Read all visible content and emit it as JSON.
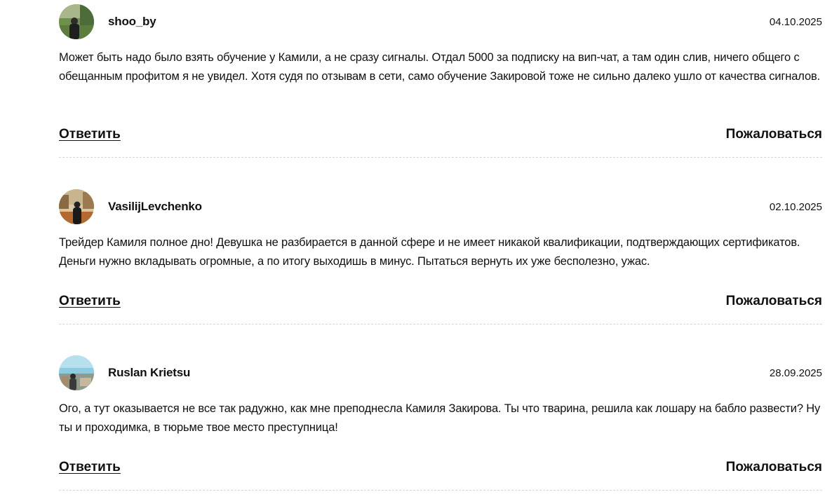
{
  "comments": [
    {
      "author": "shoo_by",
      "date": "04.10.2025",
      "text": "Может быть надо было взять обучение у Камили, а не сразу сигналы. Отдал 5000 за подписку на вип-чат, а там один слив, ничего общего с обещанным профитом я не увидел. Хотя судя по отзывам в сети, само обучение Закировой тоже не сильно далеко ушло от качества сигналов.",
      "reply_label": "Ответить",
      "report_label": "Пожаловаться"
    },
    {
      "author": "VasilijLevchenko",
      "date": "02.10.2025",
      "text": "Трейдер Камиля полное дно! Девушка не разбирается в данной сфере и не имеет никакой квалификации, подтверждающих сертификатов. Деньги нужно вкладывать огромные, а по итогу выходишь в минус. Пытаться вернуть их уже бесполезно, ужас.",
      "reply_label": "Ответить",
      "report_label": "Пожаловаться"
    },
    {
      "author": "Ruslan Krietsu",
      "date": "28.09.2025",
      "text": "Ого, а тут оказывается не все так радужно, как мне преподнесла Камиля Закирова. Ты что тварина, решила как лошару на бабло развести? Ну ты и проходимка, в тюрьме твое место преступница!",
      "reply_label": "Ответить",
      "report_label": "Пожаловаться"
    }
  ],
  "colors": {
    "text": "#111111",
    "divider": "#d6d6d6",
    "background": "#ffffff"
  }
}
